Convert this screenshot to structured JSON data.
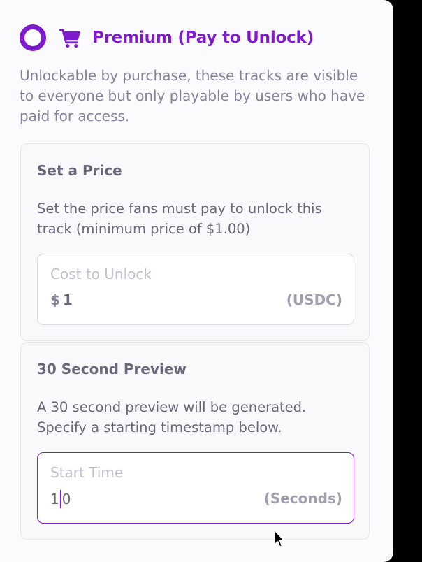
{
  "option": {
    "title": "Premium (Pay to Unlock)",
    "description": "Unlockable by purchase, these tracks are visible to everyone but only playable by users who have paid for access.",
    "icon": "cart-icon",
    "selected": false,
    "accent_color": "#7e1bcc"
  },
  "price_card": {
    "title": "Set a Price",
    "description": "Set the price fans must pay to unlock this track (minimum price of $1.00)",
    "field": {
      "label": "Cost to Unlock",
      "prefix": "$",
      "value": "1",
      "suffix": "(USDC)"
    }
  },
  "preview_card": {
    "title": "30 Second Preview",
    "description": "A 30 second preview will be generated. Specify a starting timestamp below.",
    "field": {
      "label": "Start Time",
      "value_before_caret": "1",
      "value_after_caret": "0",
      "suffix": "(Seconds)"
    }
  }
}
